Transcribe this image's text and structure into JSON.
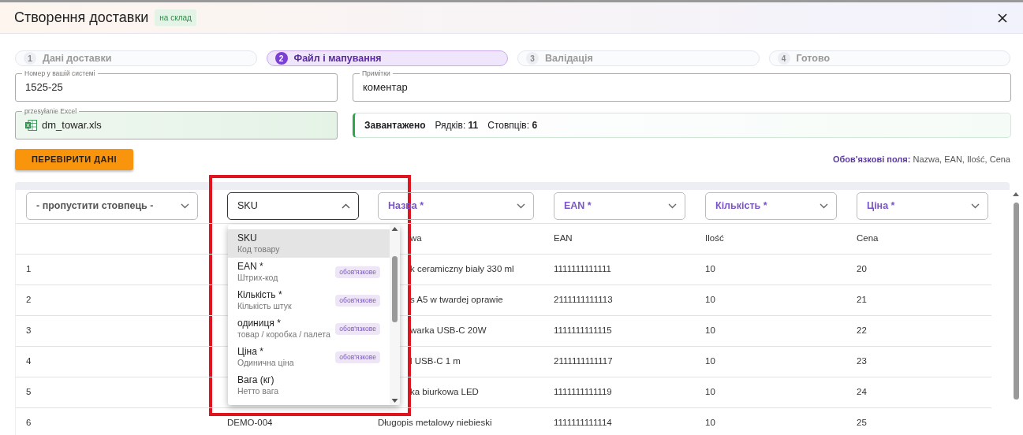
{
  "modal": {
    "title": "Створення доставки",
    "badge": "на склад"
  },
  "steps": [
    {
      "number": "1",
      "label": "Дані доставки",
      "selected": false
    },
    {
      "number": "2",
      "label": "Файл і мапування",
      "selected": true
    },
    {
      "number": "3",
      "label": "Валідація",
      "selected": false
    },
    {
      "number": "4",
      "label": "Готово",
      "selected": false
    }
  ],
  "fields": {
    "reference": {
      "label": "Номер у вашій системі",
      "value": "1525-25"
    },
    "notes": {
      "label": "Примітки",
      "value": "коментар"
    },
    "upload": {
      "label": "przesyłanie Excel",
      "file": "dm_towar.xls"
    }
  },
  "summary": {
    "status": "Завантажено",
    "rows_label": "Рядків:",
    "rows": "11",
    "cols_label": "Стовпців:",
    "cols": "6"
  },
  "validate_button": "ПЕРЕВІРИТИ ДАНІ",
  "required_note": {
    "label": "Обов'язкові поля:",
    "fields": "Nazwa, EAN, Ilość, Cena"
  },
  "mappings": [
    {
      "value": "- пропустити стовпець -",
      "required": false,
      "open": false
    },
    {
      "value": "SKU",
      "required": false,
      "open": true
    },
    {
      "value": "Назва *",
      "required": true,
      "open": false
    },
    {
      "value": "EAN *",
      "required": true,
      "open": false
    },
    {
      "value": "Кількість *",
      "required": true,
      "open": false
    },
    {
      "value": "Ціна *",
      "required": true,
      "open": false
    }
  ],
  "dropdown": [
    {
      "label": "SKU",
      "hint": "Код товару",
      "selected": true
    },
    {
      "label": "EAN *",
      "hint": "Штрих-код",
      "tag": "обов'язкове",
      "selected": false
    },
    {
      "label": "Кількість *",
      "hint": "Кількість штук",
      "tag": "обов'язкове",
      "selected": false
    },
    {
      "label": "одиниця *",
      "hint": "товар / коробка / палета",
      "tag": "обов'язкове",
      "selected": false
    },
    {
      "label": "Ціна *",
      "hint": "Одинична ціна",
      "tag": "обов'язкове",
      "selected": false
    },
    {
      "label": "Вага (кг)",
      "hint": "Нетто вага",
      "selected": false
    }
  ],
  "table": {
    "header": {
      "column_3": "wa",
      "column_4": "EAN",
      "column_5": "Ilość",
      "column_6": "Cena"
    },
    "rows": [
      {
        "column_1": "1",
        "column_3": "k ceramiczny biały 330 ml",
        "column_4": "1111111111111",
        "column_5": "10",
        "column_6": "20"
      },
      {
        "column_1": "2",
        "column_3": "s A5 w twardej oprawie",
        "column_4": "2111111111113",
        "column_5": "10",
        "column_6": "21"
      },
      {
        "column_1": "3",
        "column_3": "warka USB-C 20W",
        "column_4": "1111111111115",
        "column_5": "10",
        "column_6": "22"
      },
      {
        "column_1": "4",
        "column_3": "l USB-C 1 m",
        "column_4": "2111111111117",
        "column_5": "10",
        "column_6": "23"
      },
      {
        "column_1": "5",
        "column_3": "ka biurkowa LED",
        "column_4": "1111111111119",
        "column_5": "10",
        "column_6": "24"
      },
      {
        "column_1": "6",
        "column_2": "DEMO-004",
        "column_3": "Długopis metalowy niebieski",
        "column_4": "1111111111114",
        "column_5": "10",
        "column_6": "25"
      }
    ]
  }
}
